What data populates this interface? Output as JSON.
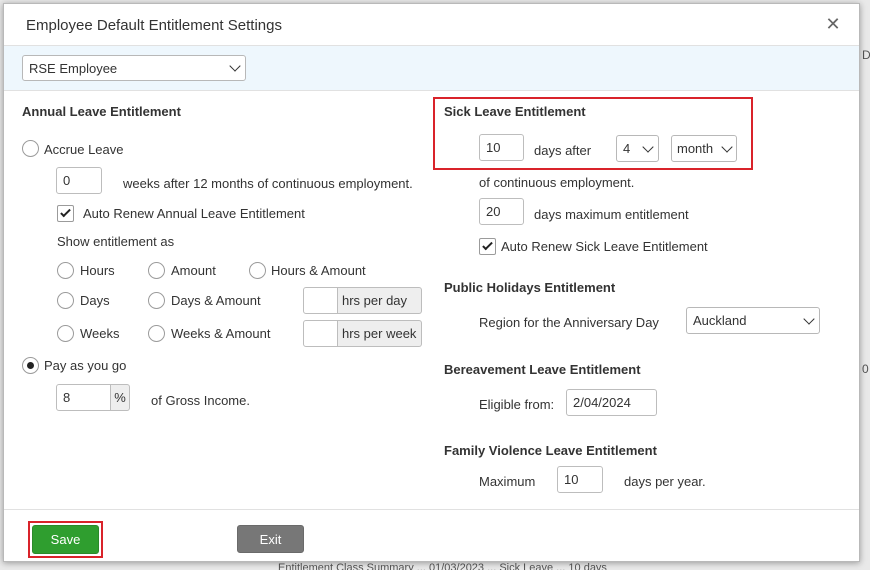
{
  "background": {
    "text_1": "D",
    "text_2": "0",
    "text_bottom": "Entitlement Class Summary ... 01/03/2023 ... Sick Leave ... 10 days"
  },
  "dialog": {
    "title": "Employee Default Entitlement Settings",
    "close_icon": "close-icon",
    "employee_type": {
      "selected": "RSE Employee"
    }
  },
  "annual": {
    "header": "Annual Leave Entitlement",
    "accrue_label": "Accrue Leave",
    "accrue_selected": false,
    "weeks_value": "0",
    "weeks_text": "weeks after 12 months of continuous employment.",
    "auto_renew_label": "Auto Renew Annual Leave Entitlement",
    "auto_renew_checked": true,
    "show_as_label": "Show entitlement as",
    "options": {
      "hours": "Hours",
      "amount": "Amount",
      "hours_amount": "Hours & Amount",
      "days": "Days",
      "days_amount": "Days & Amount",
      "weeks": "Weeks",
      "weeks_amount": "Weeks & Amount"
    },
    "hrs_per_day": "hrs per day",
    "hrs_per_week": "hrs per week",
    "payg_label": "Pay as you go",
    "payg_selected": true,
    "payg_value": "8",
    "percent": "%",
    "gross_text": "of Gross Income."
  },
  "sick": {
    "header": "Sick Leave Entitlement",
    "days_value": "10",
    "days_after": "days after",
    "period_value": "4",
    "period_unit": "month",
    "continuous_text": "of continuous employment.",
    "max_value": "20",
    "max_text": "days maximum entitlement",
    "auto_renew_label": "Auto Renew Sick Leave Entitlement",
    "auto_renew_checked": true
  },
  "public": {
    "header": "Public Holidays Entitlement",
    "region_label": "Region for the Anniversary Day",
    "region_value": "Auckland"
  },
  "bereavement": {
    "header": "Bereavement Leave Entitlement",
    "eligible_label": "Eligible from:",
    "eligible_value": "2/04/2024"
  },
  "family": {
    "header": "Family Violence Leave Entitlement",
    "max_label": "Maximum",
    "max_value": "10",
    "per_year": "days per year."
  },
  "footer": {
    "save_label": "Save",
    "exit_label": "Exit"
  },
  "colors": {
    "highlight": "#d9232a",
    "save": "#2f9e2f",
    "exit": "#777777",
    "bar": "#eef7fd"
  }
}
